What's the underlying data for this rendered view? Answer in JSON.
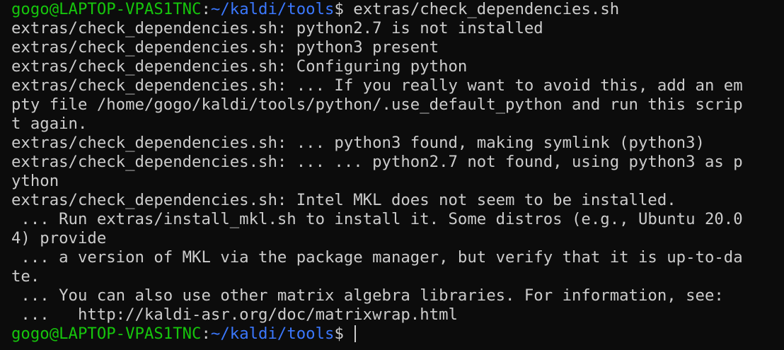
{
  "colors": {
    "background": "#0c0c0c",
    "text": "#cccccc",
    "prompt_user": "#16c60c",
    "prompt_path": "#3b78ff"
  },
  "prompt1": {
    "user_host": "gogo@LAPTOP-VPAS1TNC",
    "sep": ":",
    "path": "~/kaldi/tools",
    "dollar": "$ ",
    "command": "extras/check_dependencies.sh"
  },
  "output": [
    "extras/check_dependencies.sh: python2.7 is not installed",
    "extras/check_dependencies.sh: python3 present",
    "extras/check_dependencies.sh: Configuring python",
    "extras/check_dependencies.sh: ... If you really want to avoid this, add an em",
    "pty file /home/gogo/kaldi/tools/python/.use_default_python and run this scrip",
    "t again.",
    "extras/check_dependencies.sh: ... python3 found, making symlink (python3)",
    "extras/check_dependencies.sh: ... ... python2.7 not found, using python3 as p",
    "ython",
    "extras/check_dependencies.sh: Intel MKL does not seem to be installed.",
    " ... Run extras/install_mkl.sh to install it. Some distros (e.g., Ubuntu 20.0",
    "4) provide",
    " ... a version of MKL via the package manager, but verify that it is up-to-da",
    "te.",
    " ... You can also use other matrix algebra libraries. For information, see:",
    " ...   http://kaldi-asr.org/doc/matrixwrap.html"
  ],
  "prompt2": {
    "user_host": "gogo@LAPTOP-VPAS1TNC",
    "sep": ":",
    "path": "~/kaldi/tools",
    "dollar": "$ "
  }
}
